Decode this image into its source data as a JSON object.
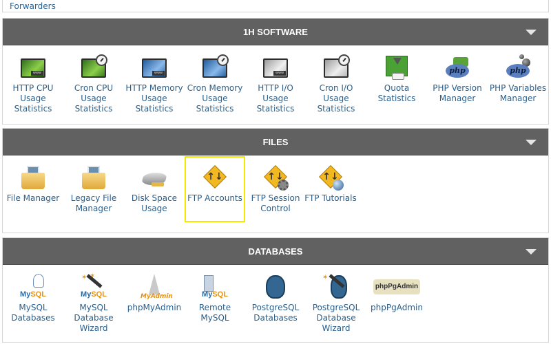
{
  "top_panel": {
    "link_label": "Forwarders"
  },
  "groups": [
    {
      "title": "1H SOFTWARE",
      "items": [
        {
          "label": "HTTP CPU Usage Statistics",
          "icon": "http-cpu-stats-icon"
        },
        {
          "label": "Cron CPU Usage Statistics",
          "icon": "cron-cpu-stats-icon"
        },
        {
          "label": "HTTP Memory Usage Statistics",
          "icon": "http-memory-stats-icon"
        },
        {
          "label": "Cron Memory Usage Statistics",
          "icon": "cron-memory-stats-icon"
        },
        {
          "label": "HTTP I/O Usage Statistics",
          "icon": "http-io-stats-icon"
        },
        {
          "label": "Cron I/O Usage Statistics",
          "icon": "cron-io-stats-icon"
        },
        {
          "label": "Quota Statistics",
          "icon": "quota-stats-icon"
        },
        {
          "label": "PHP Version Manager",
          "icon": "php-version-icon"
        },
        {
          "label": "PHP Variables Manager",
          "icon": "php-variables-icon"
        }
      ]
    },
    {
      "title": "FILES",
      "items": [
        {
          "label": "File Manager",
          "icon": "file-manager-icon"
        },
        {
          "label": "Legacy File Manager",
          "icon": "legacy-file-manager-icon"
        },
        {
          "label": "Disk Space Usage",
          "icon": "disk-space-icon"
        },
        {
          "label": "FTP Accounts",
          "icon": "ftp-accounts-icon",
          "highlighted": true
        },
        {
          "label": "FTP Session Control",
          "icon": "ftp-session-icon"
        },
        {
          "label": "FTP Tutorials",
          "icon": "ftp-tutorials-icon"
        }
      ]
    },
    {
      "title": "DATABASES",
      "items": [
        {
          "label": "MySQL Databases",
          "icon": "mysql-icon"
        },
        {
          "label": "MySQL Database Wizard",
          "icon": "mysql-wizard-icon"
        },
        {
          "label": "phpMyAdmin",
          "icon": "phpmyadmin-icon"
        },
        {
          "label": "Remote MySQL",
          "icon": "remote-mysql-icon"
        },
        {
          "label": "PostgreSQL Databases",
          "icon": "postgresql-icon"
        },
        {
          "label": "PostgreSQL Database Wizard",
          "icon": "postgresql-wizard-icon"
        },
        {
          "label": "phpPgAdmin",
          "icon": "phppgadmin-icon"
        }
      ]
    }
  ],
  "icon_text": {
    "www": "www",
    "php": "php",
    "mysql_my": "My",
    "mysql_sql": "SQL",
    "pma": "MyAdmin",
    "pga": "phpPgAdmin",
    "ftp_arrows": "↑↓",
    "sparkle": "✶"
  },
  "colors": {
    "header_bg": "#616161",
    "link": "#2b5f8a",
    "highlight": "#f5e800"
  }
}
